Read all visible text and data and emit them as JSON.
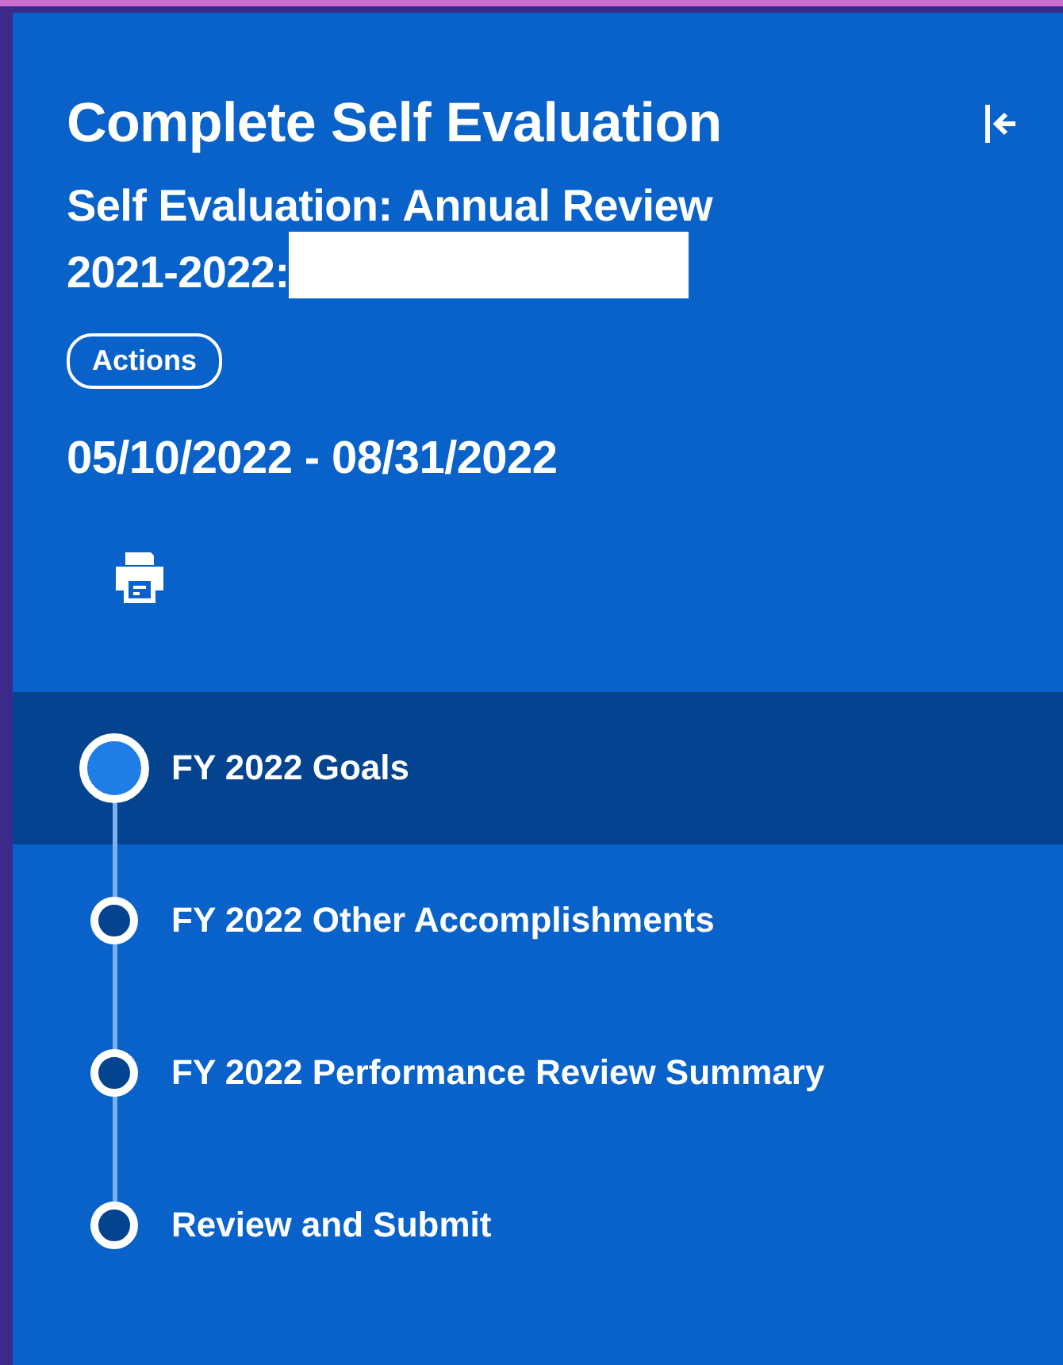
{
  "panel": {
    "title": "Complete Self Evaluation",
    "subtitle_line_1": "Self Evaluation: Annual Review",
    "subtitle_line_2": "2021-2022:",
    "actions_button": "Actions",
    "date_range": "05/10/2022 - 08/31/2022"
  },
  "steps": [
    {
      "label": "FY 2022 Goals",
      "selected": true
    },
    {
      "label": "FY 2022 Other Accomplishments",
      "selected": false
    },
    {
      "label": "FY 2022 Performance Review Summary",
      "selected": false
    },
    {
      "label": "Review and Submit",
      "selected": false
    }
  ]
}
